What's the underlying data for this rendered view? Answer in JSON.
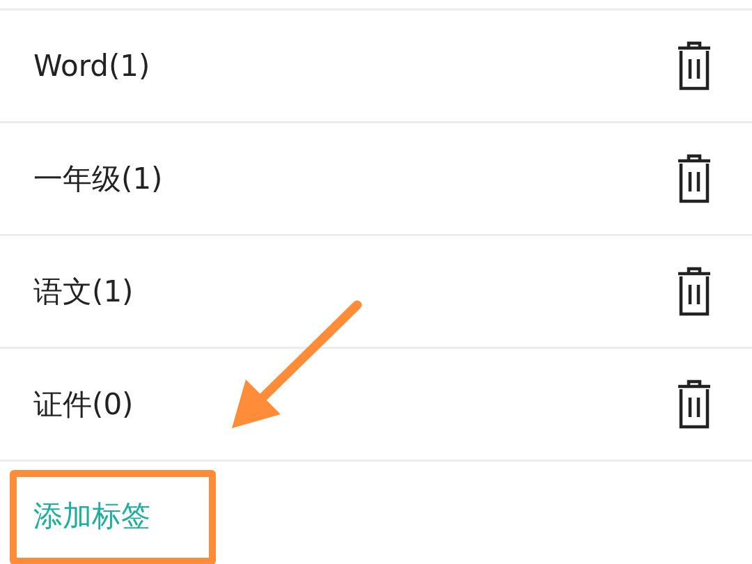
{
  "tags": [
    {
      "label": "Word(1)"
    },
    {
      "label": "一年级(1)"
    },
    {
      "label": "语文(1)"
    },
    {
      "label": "证件(0)"
    }
  ],
  "add_tag": {
    "label": "添加标签"
  }
}
